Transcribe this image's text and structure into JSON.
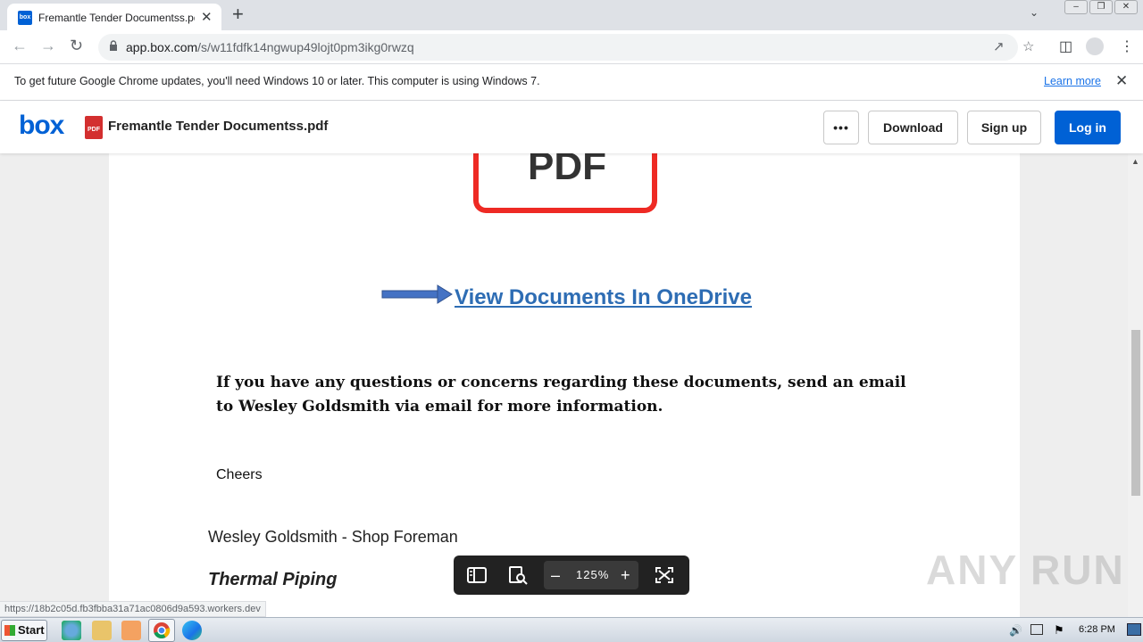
{
  "browser": {
    "tab_title": "Fremantle Tender Documentss.pdf | Powered by Box",
    "tab_close": "✕",
    "new_tab": "+",
    "url_host": "app.box.com",
    "url_path": "/s/w11fdfk14ngwup49lojt0pm3ikg0rwzq",
    "status_url": "https://18b2c05d.fb3fbba31a71ac0806d9a593.workers.dev"
  },
  "infobar": {
    "message": "To get future Google Chrome updates, you'll need Windows 10 or later. This computer is using Windows 7.",
    "learn_more": "Learn more",
    "close": "✕"
  },
  "box": {
    "logo": "box",
    "file_badge": "PDF",
    "file_name": "Fremantle Tender Documentss.pdf",
    "more": "•••",
    "download": "Download",
    "signup": "Sign up",
    "login": "Log in"
  },
  "document": {
    "pdf_graphic_text": "PDF",
    "link_text": "View Documents In OneDrive",
    "body": "If you have any questions or concerns regarding these documents, send an email to Wesley Goldsmith via email for more information.",
    "cheers": "Cheers",
    "signature": "Wesley Goldsmith - Shop Foreman",
    "company": "Thermal Piping"
  },
  "zoom": {
    "minus": "–",
    "value": "125%",
    "plus": "+"
  },
  "watermark": "ANY RUN",
  "taskbar": {
    "start": "Start",
    "clock": "6:28 PM"
  },
  "colors": {
    "box_blue": "#0061d5",
    "link_blue": "#2e6db4",
    "pdf_red": "#ee2a24"
  }
}
